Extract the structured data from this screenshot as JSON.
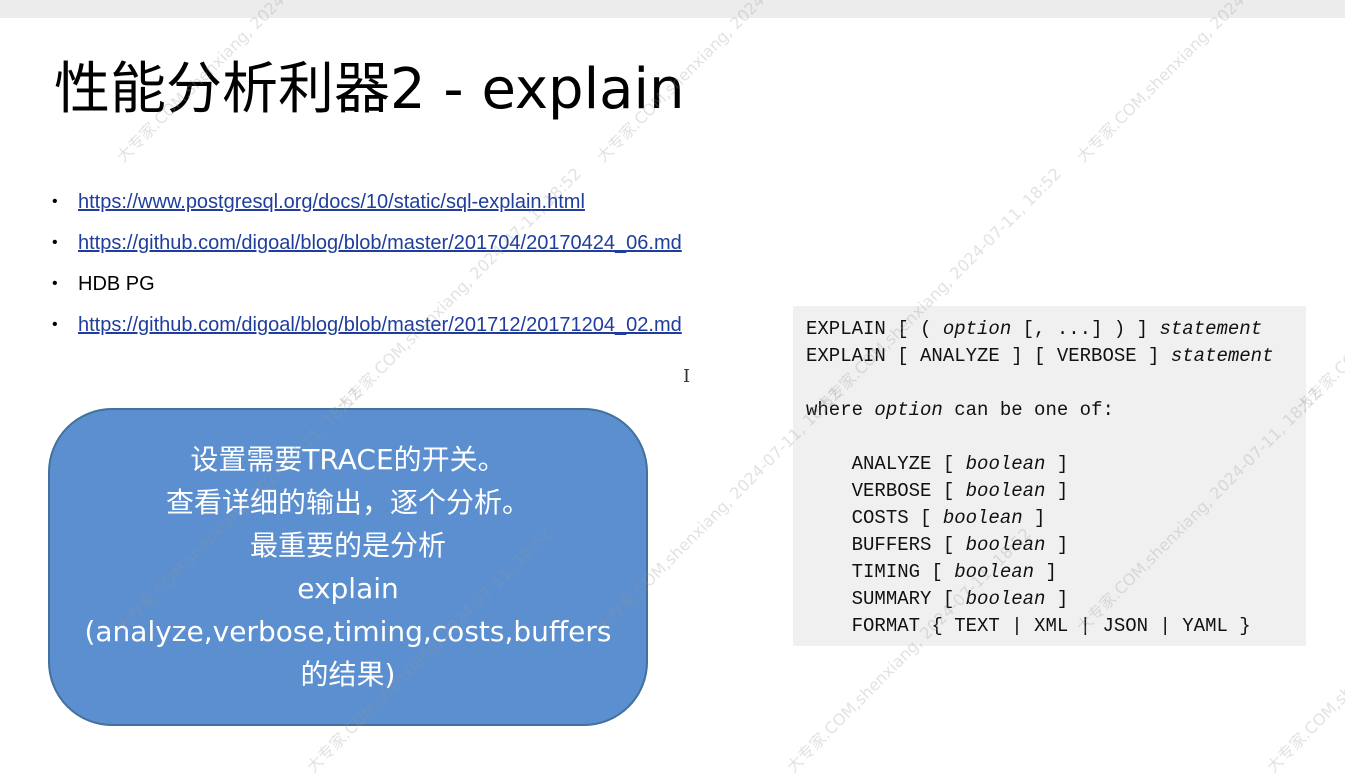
{
  "slide": {
    "title": "性能分析利器2 - explain",
    "links": [
      {
        "text": "https://www.postgresql.org/docs/10/static/sql-explain.html",
        "is_link": true
      },
      {
        "text": "https://github.com/digoal/blog/blob/master/201704/20170424_06.md",
        "is_link": true
      },
      {
        "text": "HDB PG",
        "is_link": false
      },
      {
        "text": "https://github.com/digoal/blog/blob/master/201712/20171204_02.md",
        "is_link": true
      }
    ],
    "bullet_glyph": "•",
    "callout_lines": [
      "设置需要TRACE的开关。",
      "查看详细的输出，逐个分析。",
      "最重要的是分析",
      "explain",
      "(analyze,verbose,timing,costs,buffers",
      "的结果)"
    ],
    "callout_color": "#5b8fd0",
    "code_lines": [
      [
        {
          "t": "EXPLAIN [ ( "
        },
        {
          "t": "option",
          "i": true
        },
        {
          "t": " [, ...] ) ] "
        },
        {
          "t": "statement",
          "i": true
        }
      ],
      [
        {
          "t": "EXPLAIN [ ANALYZE ] [ VERBOSE ] "
        },
        {
          "t": "statement",
          "i": true
        }
      ],
      [],
      [
        {
          "t": "where "
        },
        {
          "t": "option",
          "i": true
        },
        {
          "t": " can be one of:"
        }
      ],
      [],
      [
        {
          "t": "    ANALYZE [ "
        },
        {
          "t": "boolean",
          "i": true
        },
        {
          "t": " ]"
        }
      ],
      [
        {
          "t": "    VERBOSE [ "
        },
        {
          "t": "boolean",
          "i": true
        },
        {
          "t": " ]"
        }
      ],
      [
        {
          "t": "    COSTS [ "
        },
        {
          "t": "boolean",
          "i": true
        },
        {
          "t": " ]"
        }
      ],
      [
        {
          "t": "    BUFFERS [ "
        },
        {
          "t": "boolean",
          "i": true
        },
        {
          "t": " ]"
        }
      ],
      [
        {
          "t": "    TIMING [ "
        },
        {
          "t": "boolean",
          "i": true
        },
        {
          "t": " ]"
        }
      ],
      [
        {
          "t": "    SUMMARY [ "
        },
        {
          "t": "boolean",
          "i": true
        },
        {
          "t": " ]"
        }
      ],
      [
        {
          "t": "    FORMAT { TEXT | XML | JSON | YAML }"
        }
      ]
    ],
    "cursor_glyph": "I"
  },
  "watermark": {
    "text": "大专家.COM,shenxiang, 2024-07-11, 18:52"
  }
}
